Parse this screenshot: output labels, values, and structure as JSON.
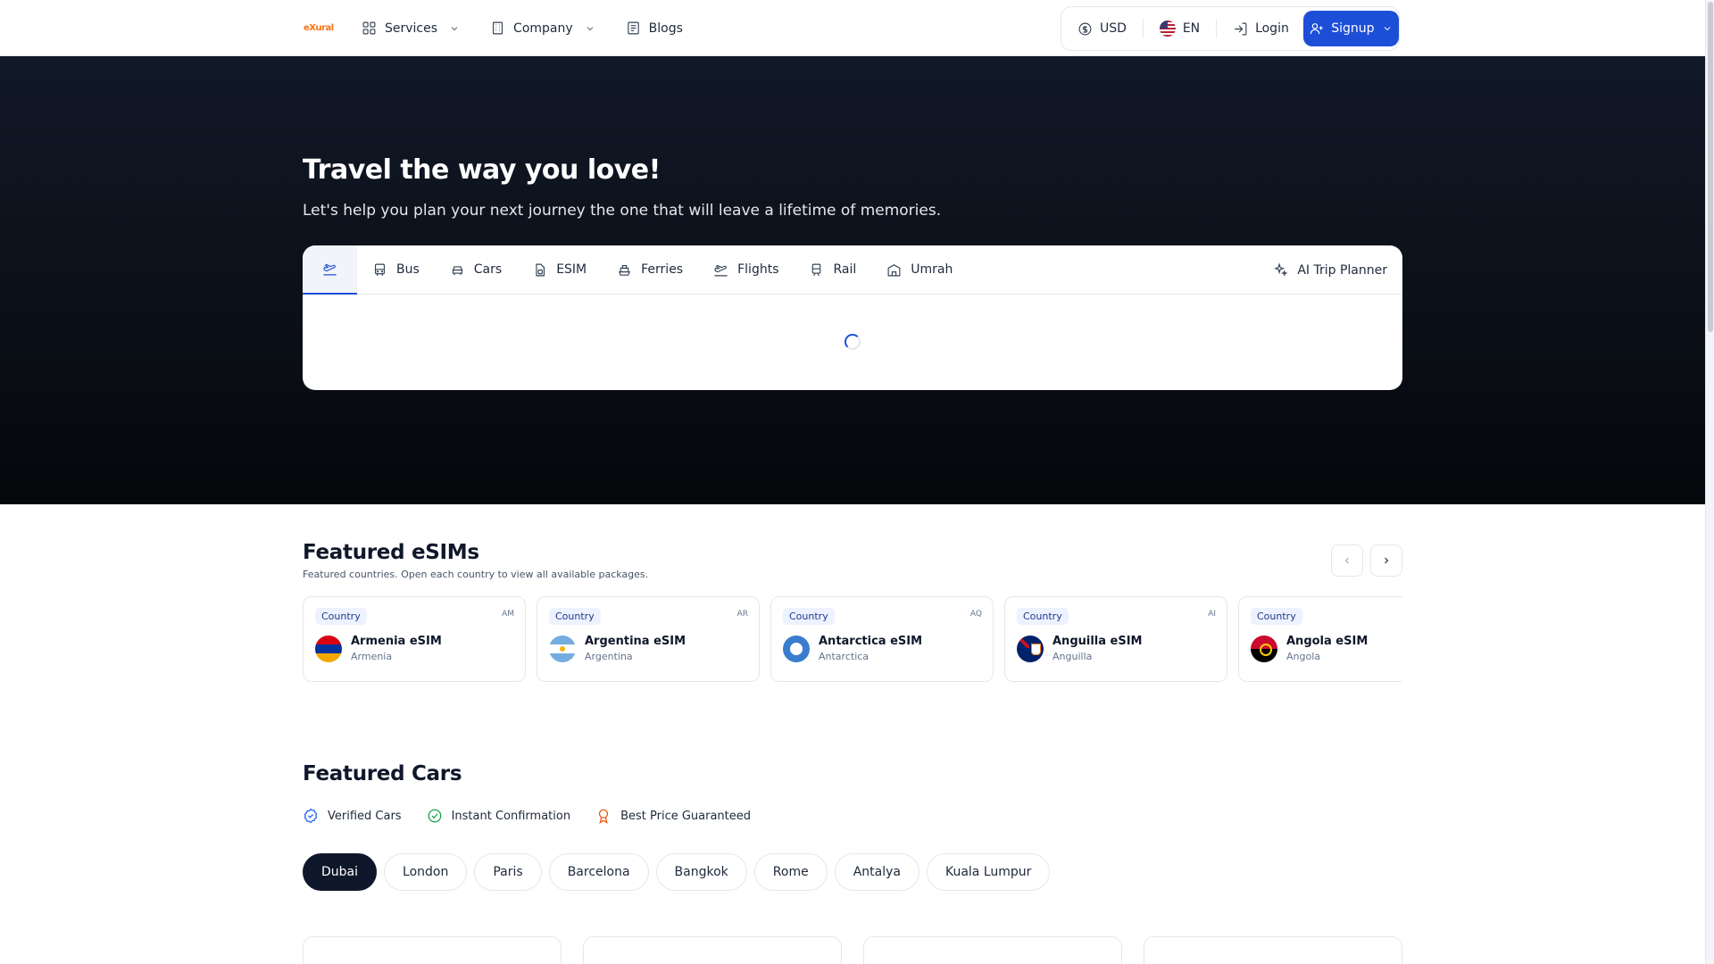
{
  "header": {
    "logo_text": "eXural",
    "nav": [
      {
        "label": "Services"
      },
      {
        "label": "Company"
      },
      {
        "label": "Blogs"
      }
    ],
    "currency": "USD",
    "language": "EN",
    "login": "Login",
    "signup": "Signup"
  },
  "hero": {
    "title": "Travel the way you love!",
    "subtitle": "Let's help you plan your next journey the one that will leave a lifetime of memories.",
    "tabs": [
      {
        "label": ""
      },
      {
        "label": "Bus"
      },
      {
        "label": "Cars"
      },
      {
        "label": "ESIM"
      },
      {
        "label": "Ferries"
      },
      {
        "label": "Flights"
      },
      {
        "label": "Rail"
      },
      {
        "label": "Umrah"
      }
    ],
    "ai_planner": "AI Trip Planner"
  },
  "esims": {
    "title": "Featured eSIMs",
    "subtitle": "Featured countries. Open each country to view all available packages.",
    "cards": [
      {
        "badge": "Country",
        "code": "AM",
        "name": "Armenia eSIM",
        "country": "Armenia"
      },
      {
        "badge": "Country",
        "code": "AR",
        "name": "Argentina eSIM",
        "country": "Argentina"
      },
      {
        "badge": "Country",
        "code": "AQ",
        "name": "Antarctica eSIM",
        "country": "Antarctica"
      },
      {
        "badge": "Country",
        "code": "AI",
        "name": "Anguilla eSIM",
        "country": "Anguilla"
      },
      {
        "badge": "Country",
        "code": "",
        "name": "Angola eSIM",
        "country": "Angola"
      }
    ]
  },
  "cars": {
    "title": "Featured Cars",
    "features": [
      {
        "label": "Verified Cars",
        "color": "#2563eb"
      },
      {
        "label": "Instant Confirmation",
        "color": "#16a34a"
      },
      {
        "label": "Best Price Guaranteed",
        "color": "#ea580c"
      }
    ],
    "cities": [
      "Dubai",
      "London",
      "Paris",
      "Barcelona",
      "Bangkok",
      "Rome",
      "Antalya",
      "Kuala Lumpur"
    ],
    "selected_city": "Dubai"
  },
  "colors": {
    "accent": "#1d4ed8",
    "hero_bg": "#0b0f17"
  }
}
